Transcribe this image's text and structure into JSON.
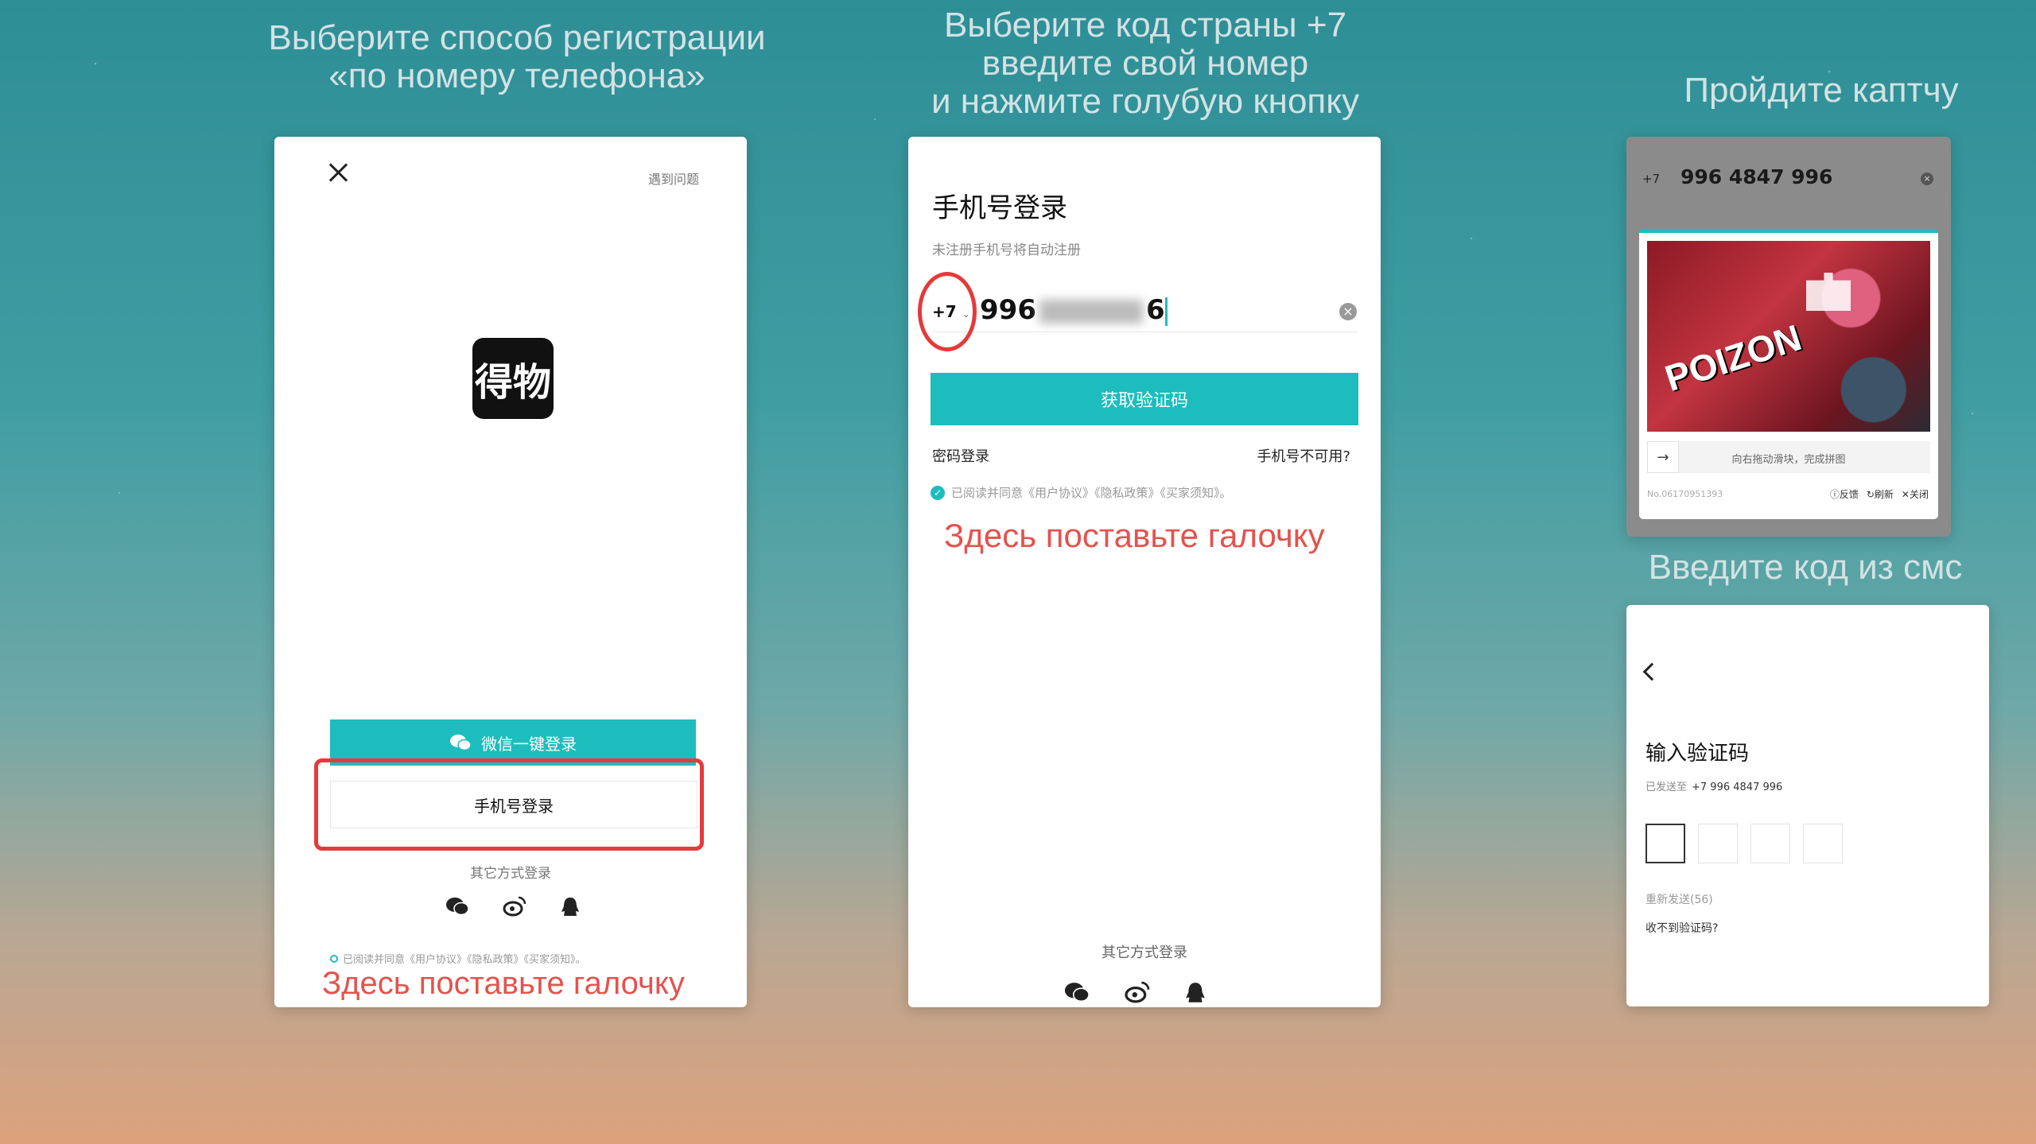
{
  "captions": {
    "step1": "Выберите способ регистрации\n«по номеру телефона»",
    "step2": "Выберите код страны +7\nвведите свой номер\nи нажмите голубую кнопку",
    "step3": "Пройдите каптчу",
    "step4": "Введите код из смс"
  },
  "panel1": {
    "trouble_link": "遇到问题",
    "logo_text": "得物",
    "wechat_login": "微信一键登录",
    "phone_login": "手机号登录",
    "other_methods": "其它方式登录",
    "agreement": "已阅读并同意《用户协议》《隐私政策》《买家须知》。",
    "annotation": "Здесь поставьте галочку"
  },
  "panel2": {
    "title": "手机号登录",
    "subtitle": "未注册手机号将自动注册",
    "country_code": "+7",
    "phone_prefix": "996",
    "phone_suffix": "6",
    "get_code_button": "获取验证码",
    "password_login": "密码登录",
    "phone_unavailable": "手机号不可用?",
    "agreement": "已阅读并同意《用户协议》《隐私政策》《买家须知》。",
    "annotation": "Здесь поставьте галочку",
    "other_methods": "其它方式登录"
  },
  "panel3": {
    "country_code": "+7",
    "phone": "996 4847 996",
    "captcha_image_text": "POIZON",
    "slider_hint": "向右拖动滑块，完成拼图",
    "captcha_id": "No.06170951393",
    "feedback": "反馈",
    "refresh": "刷新",
    "close": "关闭"
  },
  "panel4": {
    "title": "输入验证码",
    "sent_to_label": "已发送至",
    "sent_to_number": "+7 996 4847 996",
    "resend": "重新发送(56)",
    "no_code": "收不到验证码?"
  },
  "colors": {
    "accent": "#1dbdbd",
    "annotation_red": "#e53a3a"
  }
}
